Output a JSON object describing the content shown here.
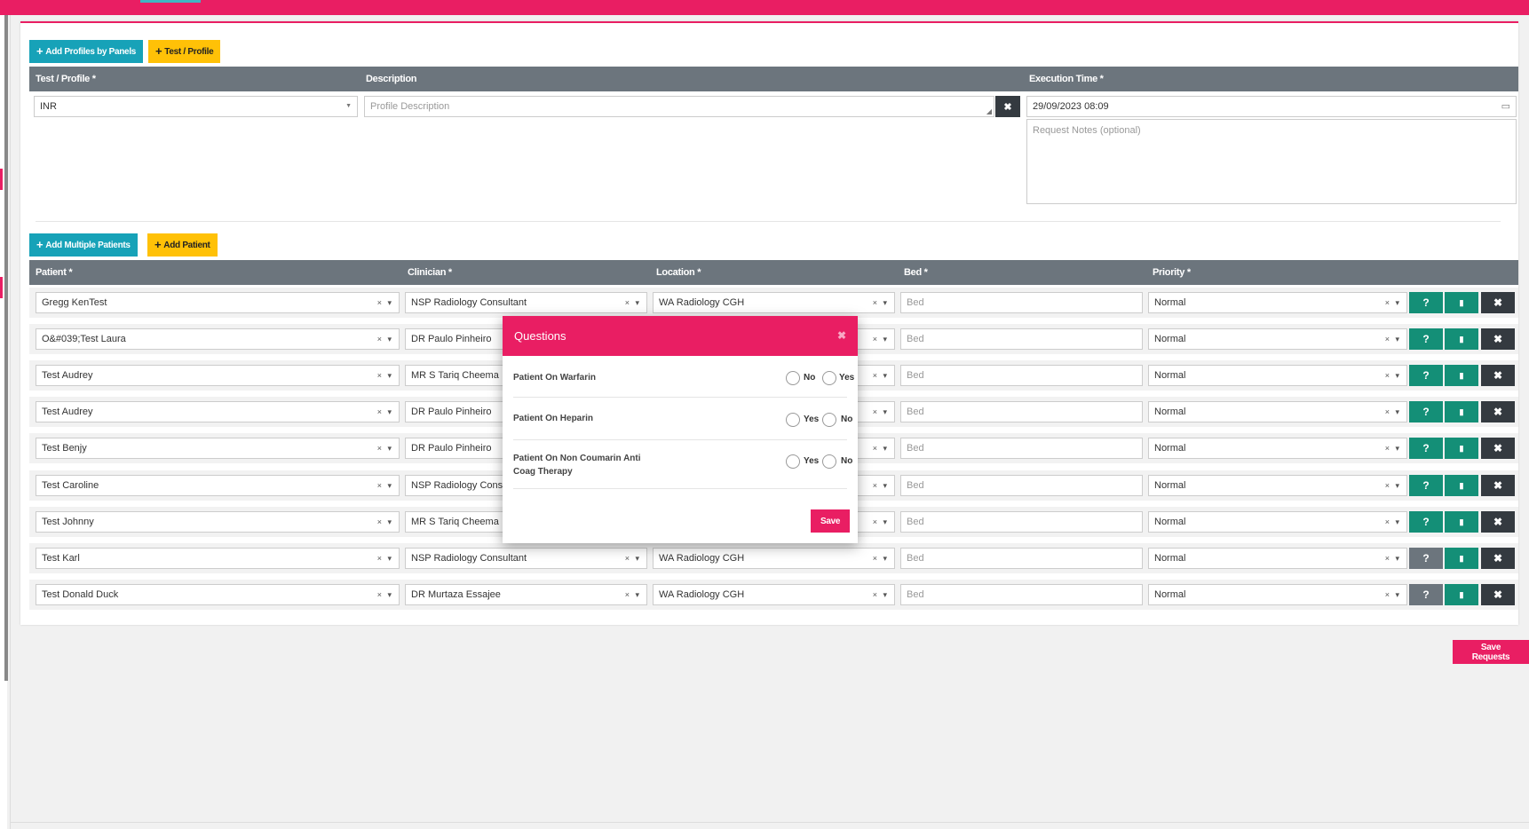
{
  "toolbar_profiles": {
    "add_profiles_label": "Add Profiles by Panels",
    "add_test_label": "Test / Profile"
  },
  "profile_table": {
    "headers": [
      "Test / Profile *",
      "Description",
      "Execution Time *"
    ],
    "test_value": "INR",
    "description_placeholder": "Profile Description",
    "execution_time": "29/09/2023 08:09",
    "notes_placeholder": "Request Notes (optional)"
  },
  "toolbar_patients": {
    "add_multiple_label": "Add Multiple Patients",
    "add_patient_label": "Add Patient"
  },
  "patient_table": {
    "headers": [
      "Patient *",
      "Clinician *",
      "Location *",
      "Bed *",
      "Priority *"
    ],
    "bed_placeholder": "Bed",
    "rows": [
      {
        "patient": "Gregg KenTest",
        "clinician": "NSP Radiology Consultant",
        "location": "WA Radiology CGH",
        "priority": "Normal",
        "question_state": "active"
      },
      {
        "patient": "O&#039;Test Laura",
        "clinician": "DR Paulo Pinheiro",
        "location": "",
        "priority": "Normal",
        "question_state": "active"
      },
      {
        "patient": "Test Audrey",
        "clinician": "MR S Tariq Cheema",
        "location": "",
        "priority": "Normal",
        "question_state": "active"
      },
      {
        "patient": "Test Audrey",
        "clinician": "DR Paulo Pinheiro",
        "location": "",
        "priority": "Normal",
        "question_state": "active"
      },
      {
        "patient": "Test Benjy",
        "clinician": "DR Paulo Pinheiro",
        "location": "",
        "priority": "Normal",
        "question_state": "active"
      },
      {
        "patient": "Test Caroline",
        "clinician": "NSP Radiology Consu",
        "location": "",
        "priority": "Normal",
        "question_state": "active"
      },
      {
        "patient": "Test Johnny",
        "clinician": "MR S Tariq Cheema",
        "location": "",
        "priority": "Normal",
        "question_state": "active"
      },
      {
        "patient": "Test Karl",
        "clinician": "NSP Radiology Consultant",
        "location": "WA Radiology CGH",
        "priority": "Normal",
        "question_state": "inactive"
      },
      {
        "patient": "Test Donald Duck",
        "clinician": "DR Murtaza Essajee",
        "location": "WA Radiology CGH",
        "priority": "Normal",
        "question_state": "inactive"
      }
    ],
    "action_icons": [
      "question-icon",
      "clipboard-icon",
      "close-icon"
    ]
  },
  "footer": {
    "save_requests_label": "Save Requests"
  },
  "modal": {
    "title": "Questions",
    "close_icon": "close-icon",
    "questions": [
      {
        "text": "Patient On Warfarin",
        "options": [
          "No",
          "Yes"
        ]
      },
      {
        "text": "Patient On Heparin",
        "options": [
          "Yes",
          "No"
        ]
      },
      {
        "text": "Patient On Non Coumarin Anti Coag Therapy",
        "options": [
          "Yes",
          "No"
        ]
      }
    ],
    "save_label": "Save"
  },
  "colors": {
    "brand": "#e91e63",
    "teal": "#17a2b8",
    "yellow": "#ffc107",
    "green": "#148f77",
    "dark": "#343a40",
    "header_grey": "#6c757d"
  }
}
